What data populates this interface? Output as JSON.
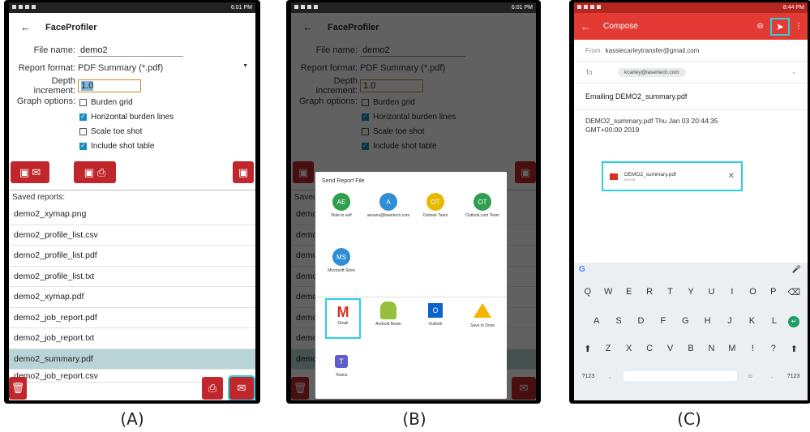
{
  "captions": {
    "a": "(A)",
    "b": "(B)",
    "c": "(C)"
  },
  "status": {
    "time_ab": "6:01 PM",
    "time_c": "8:44 PM"
  },
  "app": {
    "title": "FaceProfiler",
    "file_name_label": "File name:",
    "file_name_value": "demo2",
    "report_format_label": "Report format:",
    "report_format_value": "PDF Summary (*.pdf)",
    "depth_label": "Depth increment:",
    "depth_value": "1.0",
    "graph_options_label": "Graph options:",
    "options": [
      {
        "label": "Burden grid",
        "checked": false
      },
      {
        "label": "Horizontal burden lines",
        "checked": true
      },
      {
        "label": "Scale toe shot",
        "checked": false
      },
      {
        "label": "Include shot table",
        "checked": true
      }
    ],
    "saved_reports_label": "Saved reports:",
    "saved_reports": [
      "demo2_xymap.png",
      "demo2_profile_list.csv",
      "demo2_profile_list.pdf",
      "demo2_profile_list.txt",
      "demo2_xymap.pdf",
      "demo2_job_report.pdf",
      "demo2_job_report.txt",
      "demo2_summary.pdf",
      "demo2_job_report.csv"
    ],
    "selected_report": "demo2_summary.pdf"
  },
  "share_sheet": {
    "title": "Send Report File",
    "contacts": [
      {
        "initials": "AE",
        "label": "Note to self",
        "color": "#2e9e4f"
      },
      {
        "initials": "A",
        "label": "aevans@lasertech.com",
        "color": "#2f8fd6"
      },
      {
        "initials": "OT",
        "label": "Outlook Team",
        "color": "#e6b800"
      },
      {
        "initials": "OT",
        "label": "Outlook.com Team",
        "color": "#2e9e4f"
      },
      {
        "initials": "MS",
        "label": "Microsoft Store",
        "color": "#2f8fd6"
      }
    ],
    "apps": [
      {
        "label": "Gmail"
      },
      {
        "label": "Android Beam"
      },
      {
        "label": "Outlook"
      },
      {
        "label": "Save to Drive"
      },
      {
        "label": "Teams"
      }
    ]
  },
  "compose": {
    "title": "Compose",
    "from_label": "From",
    "from_value": "kassiecarleytransfer@gmail.com",
    "to_label": "To",
    "to_value": "kcarley@lasertech.com",
    "subject": "Emailing DEMO2_summary.pdf",
    "body": "DEMO2_summary.pdf Thu Jan 03 20:44:35 GMT+00:00 2019",
    "attachment_name": "DEMO2_summary.pdf",
    "attachment_size": "818 KB"
  },
  "keyboard": {
    "row1": [
      "Q",
      "W",
      "E",
      "R",
      "T",
      "Y",
      "U",
      "I",
      "O",
      "P"
    ],
    "row2": [
      "A",
      "S",
      "D",
      "F",
      "G",
      "H",
      "J",
      "K",
      "L"
    ],
    "row3": [
      "Z",
      "X",
      "C",
      "V",
      "B",
      "N",
      "M",
      "!",
      "?"
    ],
    "numbers_key": "?123"
  },
  "colors": {
    "accent_red": "#c0262b",
    "highlight": "#29d0e6",
    "gmail_red": "#e33b33"
  }
}
